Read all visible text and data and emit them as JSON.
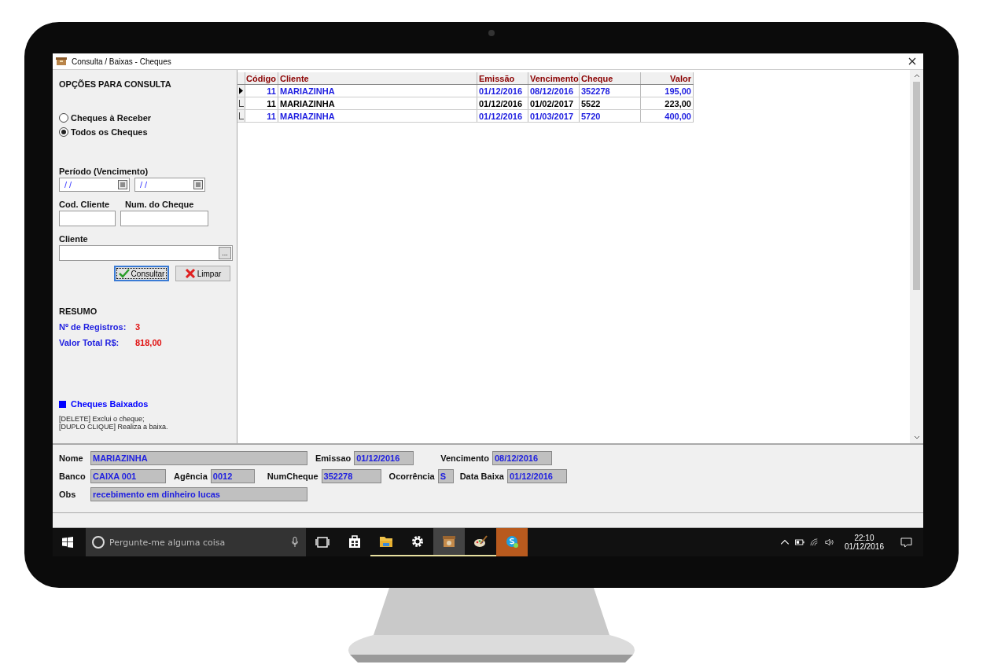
{
  "window": {
    "title": "Consulta / Baixas - Cheques"
  },
  "options": {
    "heading": "OPÇÕES PARA CONSULTA",
    "radios": [
      {
        "label": "Cheques à Receber",
        "selected": false
      },
      {
        "label": "Todos os Cheques",
        "selected": true
      }
    ],
    "period_label": "Período (Vencimento)",
    "date_from": {
      "value": "/ /"
    },
    "date_to": {
      "value": "/ /"
    },
    "client_code_label": "Cod. Cliente",
    "check_number_label": "Num. do Cheque",
    "client_label": "Cliente",
    "client_button": "...",
    "buttons": [
      {
        "kind": "search",
        "label": "Consultar",
        "focused": true
      },
      {
        "kind": "clear",
        "label": "Limpar",
        "focused": false
      }
    ]
  },
  "summary": {
    "heading": "RESUMO",
    "records_label": "Nº de Registros:",
    "records": "3",
    "total_label": "Valor Total R$:",
    "total": "818,00"
  },
  "legend": {
    "label": "Cheques Baixados",
    "color": "#0000ff"
  },
  "hints": [
    "[DELETE] Exclui o cheque;",
    "[DUPLO CLIQUE] Realiza a baixa."
  ],
  "table": {
    "columns": [
      "Código",
      "Cliente",
      "Emissão",
      "Vencimento",
      "Cheque",
      "Valor"
    ],
    "rows": [
      {
        "cells": [
          "11",
          "MARIAZINHA",
          "01/12/2016",
          "08/12/2016",
          "352278",
          "195,00"
        ],
        "selected": true,
        "settled": true
      },
      {
        "cells": [
          "11",
          "MARIAZINHA",
          "01/12/2016",
          "01/02/2017",
          "5522",
          "223,00"
        ],
        "selected": false,
        "settled": false
      },
      {
        "cells": [
          "11",
          "MARIAZINHA",
          "01/12/2016",
          "01/03/2017",
          "5720",
          "400,00"
        ],
        "selected": false,
        "settled": true
      }
    ]
  },
  "detail": {
    "nome_label": "Nome",
    "nome": "MARIAZINHA",
    "emissao_label": "Emissao",
    "emissao": "01/12/2016",
    "vencimento_label": "Vencimento",
    "vencimento": "08/12/2016",
    "banco_label": "Banco",
    "banco": "CAIXA 001",
    "agencia_label": "Agência",
    "agencia": "0012",
    "numcheque_label": "NumCheque",
    "numcheque": "352278",
    "ocorrencia_label": "Ocorrência",
    "ocorrencia": "S",
    "data_baixa_label": "Data Baixa",
    "data_baixa": "01/12/2016",
    "obs_label": "Obs",
    "obs": "recebimento em dinheiro lucas"
  },
  "taskbar": {
    "search_placeholder": "Pergunte-me alguma coisa",
    "apps": [
      {
        "kind": "store",
        "running": false,
        "active": false
      },
      {
        "kind": "folder",
        "running": true,
        "active": false
      },
      {
        "kind": "gear",
        "running": true,
        "active": false
      },
      {
        "kind": "box",
        "running": true,
        "active": true
      },
      {
        "kind": "palette",
        "running": true,
        "active": false
      },
      {
        "kind": "chat",
        "running": false,
        "active": false
      }
    ],
    "time": "22:10",
    "date": "01/12/2016"
  }
}
